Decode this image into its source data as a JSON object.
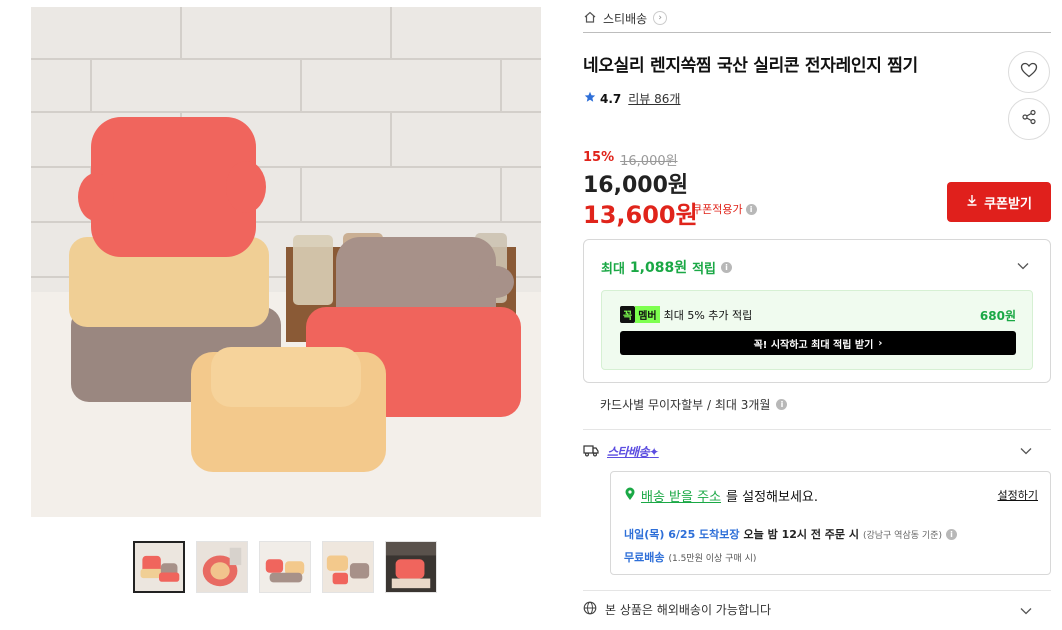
{
  "breadcrumb": {
    "home_icon": "home-icon",
    "label": "스티배송",
    "chevron": "›"
  },
  "product": {
    "title": "네오실리 렌지쏙찜 국산 실리콘 전자레인지 찜기",
    "rating": "4.7",
    "review_label": "리뷰 86개",
    "discount_rate": "15%",
    "original_price": "16,000원",
    "price": "16,000원",
    "coupon_price": "13,600원",
    "coupon_applied_label": "쿠폰적용가",
    "coupon_button": "쿠폰받기"
  },
  "points": {
    "prefix": "최대",
    "amount": "1,088원",
    "suffix": "적립",
    "member_badge_a": "꼭",
    "member_badge_b": "멤버",
    "member_text": "최대 5% 추가 적립",
    "member_amount": "680원",
    "member_cta": "꼭! 시작하고 최대 적립 받기",
    "member_cta_arrow": "›"
  },
  "installment": "카드사별 무이자할부 / 최대 3개월",
  "shipping": {
    "logo": "스타배송",
    "logo_mark": "✦",
    "address_link": "배송 받을 주소",
    "address_text": "를 설정해보세요.",
    "address_set": "설정하기",
    "eta_date": "내일(목) 6/25 도착보장",
    "eta_condition": "오늘 밤 12시 전 주문 시",
    "eta_note": "(강남구 역삼동 기준)",
    "free_label": "무료배송",
    "free_note": "(1.5만원 이상 구매 시)"
  },
  "overseas": "본 상품은 해외배송이 가능합니다",
  "colors": {
    "accent_red": "#e0201c",
    "point_green": "#1aa845",
    "member_green": "#7dff4f",
    "eta_blue": "#2e6fd8",
    "star_purple": "#5b4ce0"
  },
  "icons": [
    "home-icon",
    "heart-icon",
    "share-icon",
    "star-icon",
    "download-icon",
    "info-icon",
    "chevron-down-icon",
    "truck-icon",
    "location-pin-icon",
    "globe-icon"
  ]
}
